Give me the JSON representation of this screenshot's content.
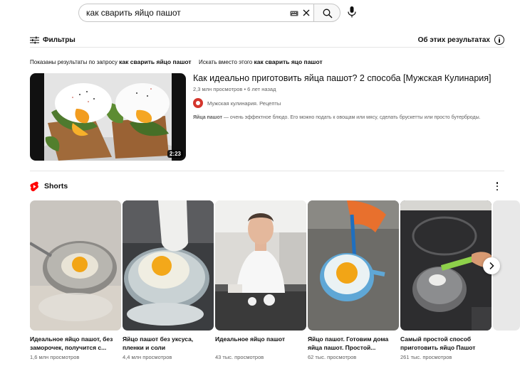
{
  "search": {
    "query": "как сварить яйцо пашот"
  },
  "filters": {
    "filters_label": "Фильтры",
    "about_label": "Об этих результатах"
  },
  "correction": {
    "shown_prefix": "Показаны результаты по запросу",
    "shown_query": "как сварить яйцо пашот",
    "instead_prefix": "Искать вместо этого",
    "instead_query": "как сварить яцо пашот"
  },
  "video": {
    "title": "Как идеально приготовить яйца пашот? 2 способа [Мужская Кулинария]",
    "views": "2,3 млн просмотров",
    "age": "6 лет назад",
    "channel": "Мужская кулинария. Рецепты",
    "desc_bold": "Яйца пашот",
    "desc_rest": " — очень эффектное блюдо. Его можно подать к овощам или мясу, сделать брускетты или просто бутерброды.",
    "duration": "2:23"
  },
  "shorts": {
    "title": "Shorts",
    "items": [
      {
        "title": "Идеальное яйцо пашот, без заморочек, получится с...",
        "views": "1,6 млн просмотров"
      },
      {
        "title": "Яйцо пашот без уксуса, пленки и соли",
        "views": "4,4 млн просмотров"
      },
      {
        "title": "Идеальное яйцо пашот",
        "views": "43 тыс. просмотров"
      },
      {
        "title": "Яйцо пашот. Готовим дома яйца пашот. Простой...",
        "views": "62 тыс. просмотров"
      },
      {
        "title": "Самый простой способ приготовить яйцо Пашот",
        "views": "261 тыс. просмотров"
      }
    ]
  },
  "colors": {
    "brand_red": "#ff0000",
    "text_primary": "#0f0f0f",
    "text_secondary": "#606060"
  }
}
